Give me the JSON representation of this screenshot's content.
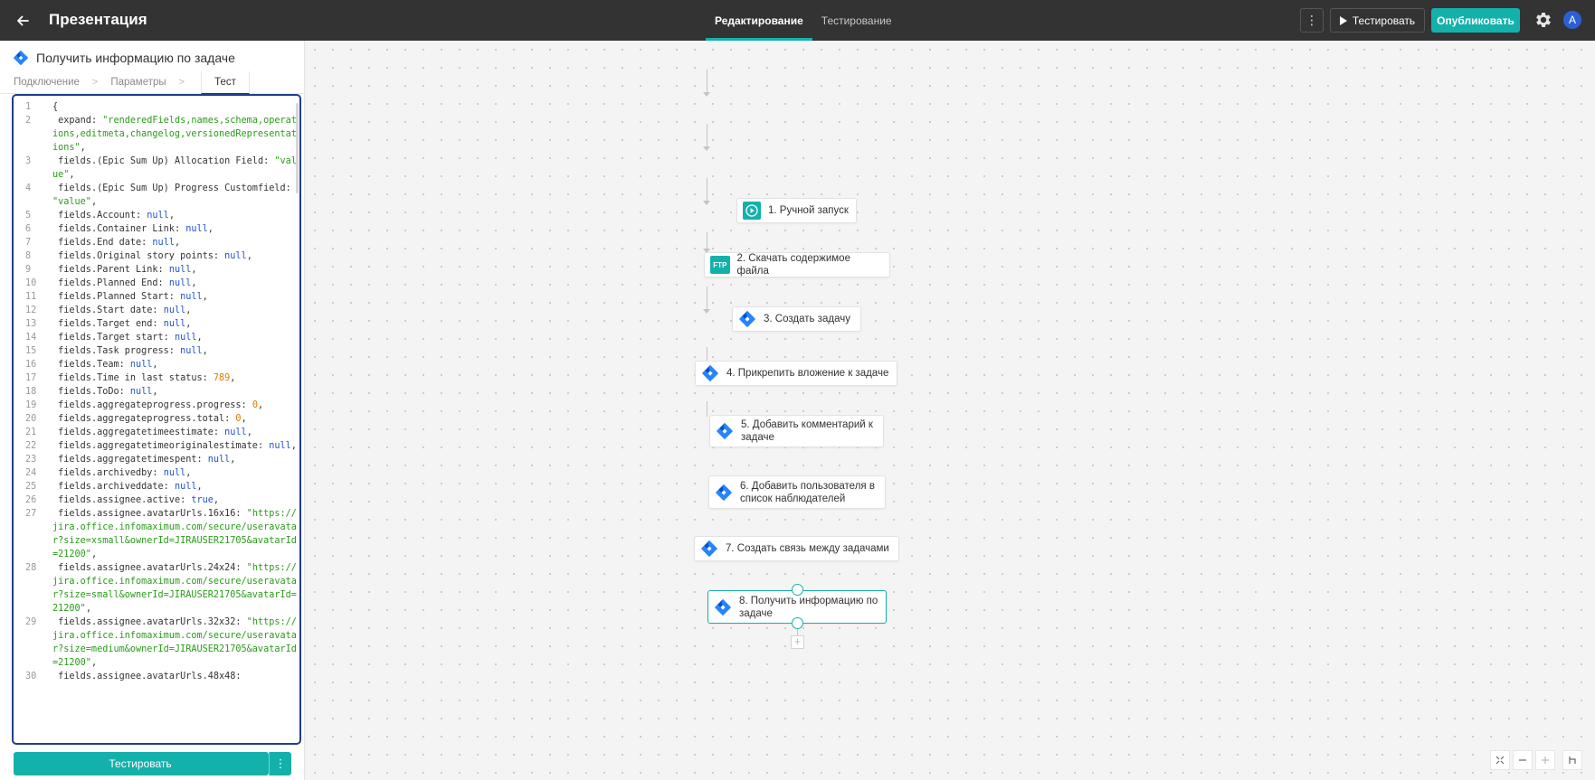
{
  "topbar": {
    "title": "Презентация",
    "tabs": [
      {
        "label": "Редактирование",
        "active": true
      },
      {
        "label": "Тестирование",
        "active": false
      }
    ],
    "more_label": "⋮",
    "test_label": "Тестировать",
    "publish_label": "Опубликовать",
    "avatar_letter": "A"
  },
  "panel": {
    "title": "Получить информацию по задаче",
    "breadcrumb": [
      "Подключение",
      "Параметры",
      "Тест"
    ],
    "run_label": "Тестировать",
    "run_more_label": "⋮",
    "code_lines": [
      {
        "n": "1",
        "parts": [
          [
            "t",
            "{"
          ]
        ]
      },
      {
        "n": "2",
        "parts": [
          [
            "t",
            " expand: "
          ],
          [
            "s",
            "\"renderedFields,names,schema,operations,editmeta,changelog,versionedRepresentations\""
          ],
          [
            "t",
            ","
          ]
        ]
      },
      {
        "n": "3",
        "parts": [
          [
            "t",
            " fields.(Epic Sum Up) Allocation Field: "
          ],
          [
            "s",
            "\"value\""
          ],
          [
            "t",
            ","
          ]
        ]
      },
      {
        "n": "4",
        "parts": [
          [
            "t",
            " fields.(Epic Sum Up) Progress Customfield: "
          ],
          [
            "s",
            "\"value\""
          ],
          [
            "t",
            ","
          ]
        ]
      },
      {
        "n": "5",
        "parts": [
          [
            "t",
            " fields.Account: "
          ],
          [
            "k",
            "null"
          ],
          [
            "t",
            ","
          ]
        ]
      },
      {
        "n": "6",
        "parts": [
          [
            "t",
            " fields.Container Link: "
          ],
          [
            "k",
            "null"
          ],
          [
            "t",
            ","
          ]
        ]
      },
      {
        "n": "7",
        "parts": [
          [
            "t",
            " fields.End date: "
          ],
          [
            "k",
            "null"
          ],
          [
            "t",
            ","
          ]
        ]
      },
      {
        "n": "8",
        "parts": [
          [
            "t",
            " fields.Original story points: "
          ],
          [
            "k",
            "null"
          ],
          [
            "t",
            ","
          ]
        ]
      },
      {
        "n": "9",
        "parts": [
          [
            "t",
            " fields.Parent Link: "
          ],
          [
            "k",
            "null"
          ],
          [
            "t",
            ","
          ]
        ]
      },
      {
        "n": "10",
        "parts": [
          [
            "t",
            " fields.Planned End: "
          ],
          [
            "k",
            "null"
          ],
          [
            "t",
            ","
          ]
        ]
      },
      {
        "n": "11",
        "parts": [
          [
            "t",
            " fields.Planned Start: "
          ],
          [
            "k",
            "null"
          ],
          [
            "t",
            ","
          ]
        ]
      },
      {
        "n": "12",
        "parts": [
          [
            "t",
            " fields.Start date: "
          ],
          [
            "k",
            "null"
          ],
          [
            "t",
            ","
          ]
        ]
      },
      {
        "n": "13",
        "parts": [
          [
            "t",
            " fields.Target end: "
          ],
          [
            "k",
            "null"
          ],
          [
            "t",
            ","
          ]
        ]
      },
      {
        "n": "14",
        "parts": [
          [
            "t",
            " fields.Target start: "
          ],
          [
            "k",
            "null"
          ],
          [
            "t",
            ","
          ]
        ]
      },
      {
        "n": "15",
        "parts": [
          [
            "t",
            " fields.Task progress: "
          ],
          [
            "k",
            "null"
          ],
          [
            "t",
            ","
          ]
        ]
      },
      {
        "n": "16",
        "parts": [
          [
            "t",
            " fields.Team: "
          ],
          [
            "k",
            "null"
          ],
          [
            "t",
            ","
          ]
        ]
      },
      {
        "n": "17",
        "parts": [
          [
            "t",
            " fields.Time in last status: "
          ],
          [
            "n",
            "789"
          ],
          [
            "t",
            ","
          ]
        ]
      },
      {
        "n": "18",
        "parts": [
          [
            "t",
            " fields.ToDo: "
          ],
          [
            "k",
            "null"
          ],
          [
            "t",
            ","
          ]
        ]
      },
      {
        "n": "19",
        "parts": [
          [
            "t",
            " fields.aggregateprogress.progress: "
          ],
          [
            "n",
            "0"
          ],
          [
            "t",
            ","
          ]
        ]
      },
      {
        "n": "20",
        "parts": [
          [
            "t",
            " fields.aggregateprogress.total: "
          ],
          [
            "n",
            "0"
          ],
          [
            "t",
            ","
          ]
        ]
      },
      {
        "n": "21",
        "parts": [
          [
            "t",
            " fields.aggregatetimeestimate: "
          ],
          [
            "k",
            "null"
          ],
          [
            "t",
            ","
          ]
        ]
      },
      {
        "n": "22",
        "parts": [
          [
            "t",
            " fields.aggregatetimeoriginalestimate: "
          ],
          [
            "k",
            "null"
          ],
          [
            "t",
            ","
          ]
        ]
      },
      {
        "n": "23",
        "parts": [
          [
            "t",
            " fields.aggregatetimespent: "
          ],
          [
            "k",
            "null"
          ],
          [
            "t",
            ","
          ]
        ]
      },
      {
        "n": "24",
        "parts": [
          [
            "t",
            " fields.archivedby: "
          ],
          [
            "k",
            "null"
          ],
          [
            "t",
            ","
          ]
        ]
      },
      {
        "n": "25",
        "parts": [
          [
            "t",
            " fields.archiveddate: "
          ],
          [
            "k",
            "null"
          ],
          [
            "t",
            ","
          ]
        ]
      },
      {
        "n": "26",
        "parts": [
          [
            "t",
            " fields.assignee.active: "
          ],
          [
            "k",
            "true"
          ],
          [
            "t",
            ","
          ]
        ]
      },
      {
        "n": "27",
        "parts": [
          [
            "t",
            " fields.assignee.avatarUrls.16x16: "
          ],
          [
            "s",
            "\"https://jira.office.infomaximum.com/secure/useravatar?size=xsmall&ownerId=JIRAUSER21705&avatarId=21200\""
          ],
          [
            "t",
            ","
          ]
        ]
      },
      {
        "n": "28",
        "parts": [
          [
            "t",
            " fields.assignee.avatarUrls.24x24: "
          ],
          [
            "s",
            "\"https://jira.office.infomaximum.com/secure/useravatar?size=small&ownerId=JIRAUSER21705&avatarId=21200\""
          ],
          [
            "t",
            ","
          ]
        ]
      },
      {
        "n": "29",
        "parts": [
          [
            "t",
            " fields.assignee.avatarUrls.32x32: "
          ],
          [
            "s",
            "\"https://jira.office.infomaximum.com/secure/useravatar?size=medium&ownerId=JIRAUSER21705&avatarId=21200\""
          ],
          [
            "t",
            ","
          ]
        ]
      },
      {
        "n": "30",
        "parts": [
          [
            "t",
            " fields.assignee.avatarUrls.48x48: "
          ]
        ]
      }
    ]
  },
  "flow": {
    "nodes": [
      {
        "label": "1. Ручной запуск",
        "icon": "play-icon"
      },
      {
        "label": "2. Скачать содержимое файла",
        "icon": "ftp-icon",
        "icon_text": "FTP"
      },
      {
        "label": "3. Создать задачу",
        "icon": "jira-icon"
      },
      {
        "label": "4. Прикрепить вложение к задаче",
        "icon": "jira-icon"
      },
      {
        "label": "5. Добавить комментарий к задаче",
        "icon": "jira-icon"
      },
      {
        "label": "6. Добавить пользователя в список наблюдателей",
        "icon": "jira-icon"
      },
      {
        "label": "7. Создать связь между задачами",
        "icon": "jira-icon"
      },
      {
        "label": "8. Получить информацию по задаче",
        "icon": "jira-icon",
        "selected": true
      }
    ],
    "add_label": "+"
  },
  "colors": {
    "accent": "#14b1ab",
    "topbar": "#333333",
    "jira_blue": "#2684ff",
    "editor_border": "#1f3e8f"
  }
}
